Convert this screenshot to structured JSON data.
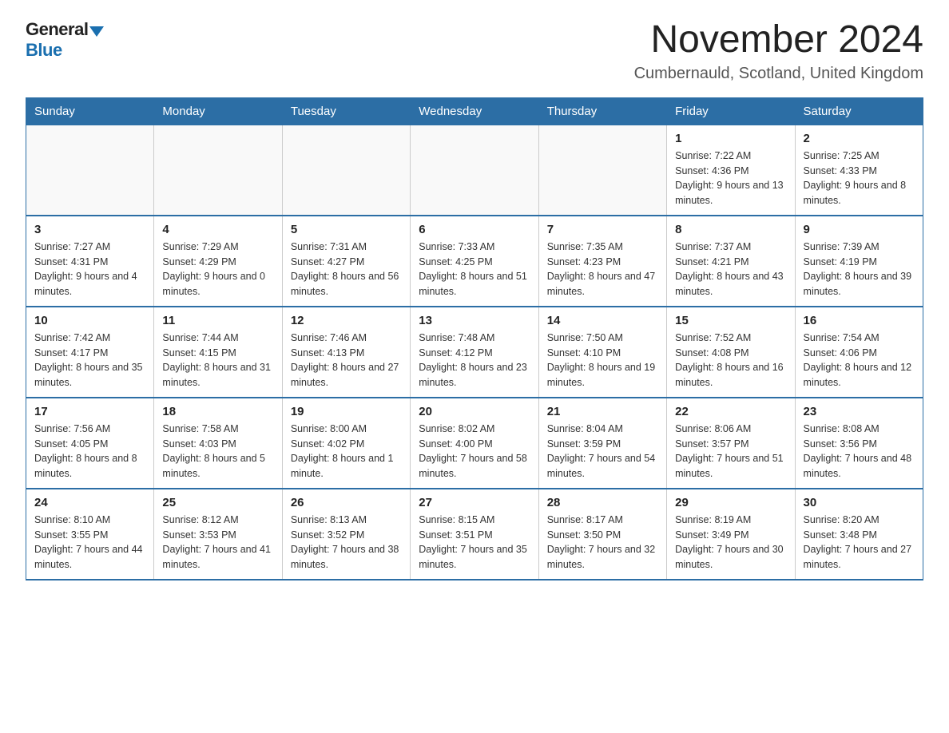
{
  "logo": {
    "general": "General",
    "blue": "Blue"
  },
  "title": "November 2024",
  "subtitle": "Cumbernauld, Scotland, United Kingdom",
  "days_of_week": [
    "Sunday",
    "Monday",
    "Tuesday",
    "Wednesday",
    "Thursday",
    "Friday",
    "Saturday"
  ],
  "weeks": [
    [
      {
        "day": "",
        "info": ""
      },
      {
        "day": "",
        "info": ""
      },
      {
        "day": "",
        "info": ""
      },
      {
        "day": "",
        "info": ""
      },
      {
        "day": "",
        "info": ""
      },
      {
        "day": "1",
        "info": "Sunrise: 7:22 AM\nSunset: 4:36 PM\nDaylight: 9 hours and 13 minutes."
      },
      {
        "day": "2",
        "info": "Sunrise: 7:25 AM\nSunset: 4:33 PM\nDaylight: 9 hours and 8 minutes."
      }
    ],
    [
      {
        "day": "3",
        "info": "Sunrise: 7:27 AM\nSunset: 4:31 PM\nDaylight: 9 hours and 4 minutes."
      },
      {
        "day": "4",
        "info": "Sunrise: 7:29 AM\nSunset: 4:29 PM\nDaylight: 9 hours and 0 minutes."
      },
      {
        "day": "5",
        "info": "Sunrise: 7:31 AM\nSunset: 4:27 PM\nDaylight: 8 hours and 56 minutes."
      },
      {
        "day": "6",
        "info": "Sunrise: 7:33 AM\nSunset: 4:25 PM\nDaylight: 8 hours and 51 minutes."
      },
      {
        "day": "7",
        "info": "Sunrise: 7:35 AM\nSunset: 4:23 PM\nDaylight: 8 hours and 47 minutes."
      },
      {
        "day": "8",
        "info": "Sunrise: 7:37 AM\nSunset: 4:21 PM\nDaylight: 8 hours and 43 minutes."
      },
      {
        "day": "9",
        "info": "Sunrise: 7:39 AM\nSunset: 4:19 PM\nDaylight: 8 hours and 39 minutes."
      }
    ],
    [
      {
        "day": "10",
        "info": "Sunrise: 7:42 AM\nSunset: 4:17 PM\nDaylight: 8 hours and 35 minutes."
      },
      {
        "day": "11",
        "info": "Sunrise: 7:44 AM\nSunset: 4:15 PM\nDaylight: 8 hours and 31 minutes."
      },
      {
        "day": "12",
        "info": "Sunrise: 7:46 AM\nSunset: 4:13 PM\nDaylight: 8 hours and 27 minutes."
      },
      {
        "day": "13",
        "info": "Sunrise: 7:48 AM\nSunset: 4:12 PM\nDaylight: 8 hours and 23 minutes."
      },
      {
        "day": "14",
        "info": "Sunrise: 7:50 AM\nSunset: 4:10 PM\nDaylight: 8 hours and 19 minutes."
      },
      {
        "day": "15",
        "info": "Sunrise: 7:52 AM\nSunset: 4:08 PM\nDaylight: 8 hours and 16 minutes."
      },
      {
        "day": "16",
        "info": "Sunrise: 7:54 AM\nSunset: 4:06 PM\nDaylight: 8 hours and 12 minutes."
      }
    ],
    [
      {
        "day": "17",
        "info": "Sunrise: 7:56 AM\nSunset: 4:05 PM\nDaylight: 8 hours and 8 minutes."
      },
      {
        "day": "18",
        "info": "Sunrise: 7:58 AM\nSunset: 4:03 PM\nDaylight: 8 hours and 5 minutes."
      },
      {
        "day": "19",
        "info": "Sunrise: 8:00 AM\nSunset: 4:02 PM\nDaylight: 8 hours and 1 minute."
      },
      {
        "day": "20",
        "info": "Sunrise: 8:02 AM\nSunset: 4:00 PM\nDaylight: 7 hours and 58 minutes."
      },
      {
        "day": "21",
        "info": "Sunrise: 8:04 AM\nSunset: 3:59 PM\nDaylight: 7 hours and 54 minutes."
      },
      {
        "day": "22",
        "info": "Sunrise: 8:06 AM\nSunset: 3:57 PM\nDaylight: 7 hours and 51 minutes."
      },
      {
        "day": "23",
        "info": "Sunrise: 8:08 AM\nSunset: 3:56 PM\nDaylight: 7 hours and 48 minutes."
      }
    ],
    [
      {
        "day": "24",
        "info": "Sunrise: 8:10 AM\nSunset: 3:55 PM\nDaylight: 7 hours and 44 minutes."
      },
      {
        "day": "25",
        "info": "Sunrise: 8:12 AM\nSunset: 3:53 PM\nDaylight: 7 hours and 41 minutes."
      },
      {
        "day": "26",
        "info": "Sunrise: 8:13 AM\nSunset: 3:52 PM\nDaylight: 7 hours and 38 minutes."
      },
      {
        "day": "27",
        "info": "Sunrise: 8:15 AM\nSunset: 3:51 PM\nDaylight: 7 hours and 35 minutes."
      },
      {
        "day": "28",
        "info": "Sunrise: 8:17 AM\nSunset: 3:50 PM\nDaylight: 7 hours and 32 minutes."
      },
      {
        "day": "29",
        "info": "Sunrise: 8:19 AM\nSunset: 3:49 PM\nDaylight: 7 hours and 30 minutes."
      },
      {
        "day": "30",
        "info": "Sunrise: 8:20 AM\nSunset: 3:48 PM\nDaylight: 7 hours and 27 minutes."
      }
    ]
  ]
}
